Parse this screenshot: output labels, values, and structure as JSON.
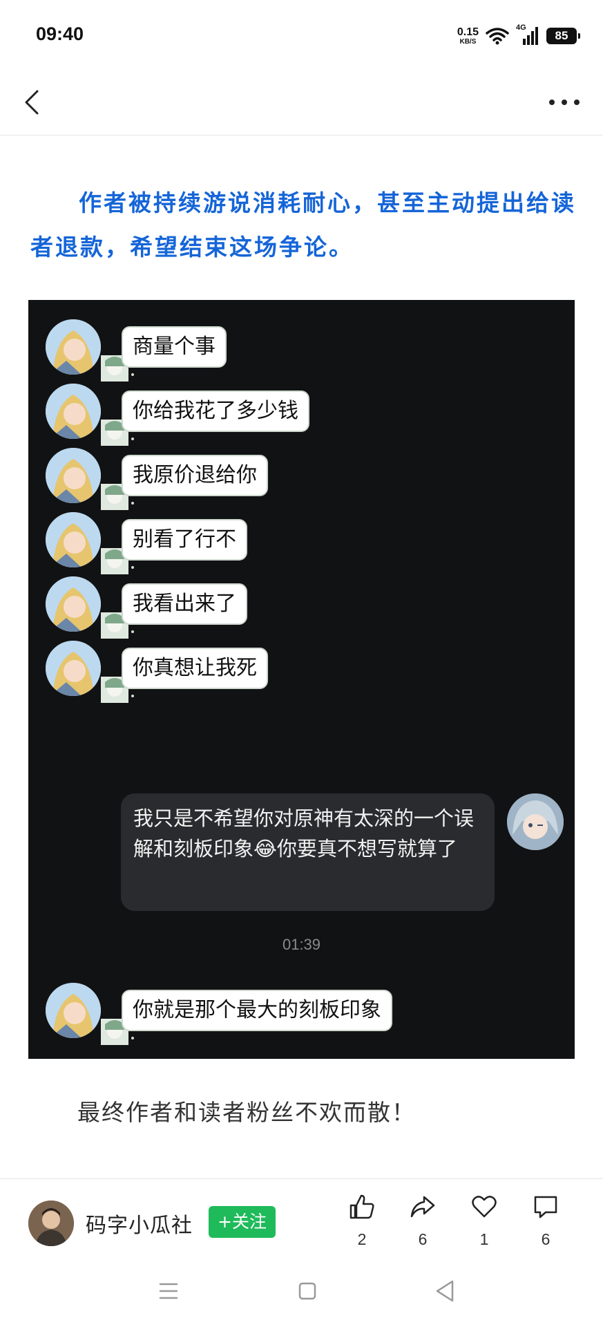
{
  "status_bar": {
    "time": "09:40",
    "net_speed_value": "0.15",
    "net_speed_unit": "KB/S",
    "network_type": "4G",
    "battery": "85"
  },
  "header": {
    "back_icon": "chevron-left-icon",
    "more_icon": "more-horizontal-icon"
  },
  "article": {
    "intro": "作者被持续游说消耗耐心，甚至主动提出给读者退款，希望结束这场争论。",
    "outro": "最终作者和读者粉丝不欢而散！"
  },
  "chat_screenshot": {
    "messages_left": [
      {
        "text": "商量个事"
      },
      {
        "text": "你给我花了多少钱"
      },
      {
        "text": "我原价退给你"
      },
      {
        "text": "别看了行不"
      },
      {
        "text": "我看出来了"
      },
      {
        "text": "你真想让我死"
      }
    ],
    "message_right": "我只是不希望你对原神有太深的一个误解和刻板印象😂你要真不想写就算了",
    "timestamp": "01:39",
    "last_message": "你就是那个最大的刻板印象"
  },
  "author": {
    "name": "码字小瓜社",
    "follow_label": "+关注"
  },
  "actions": {
    "like_count": "2",
    "share_count": "6",
    "favorite_count": "1",
    "comment_count": "6"
  },
  "colors": {
    "accent_blue": "#1565d8",
    "follow_green": "#1fba5a",
    "chat_bg": "#111214"
  }
}
